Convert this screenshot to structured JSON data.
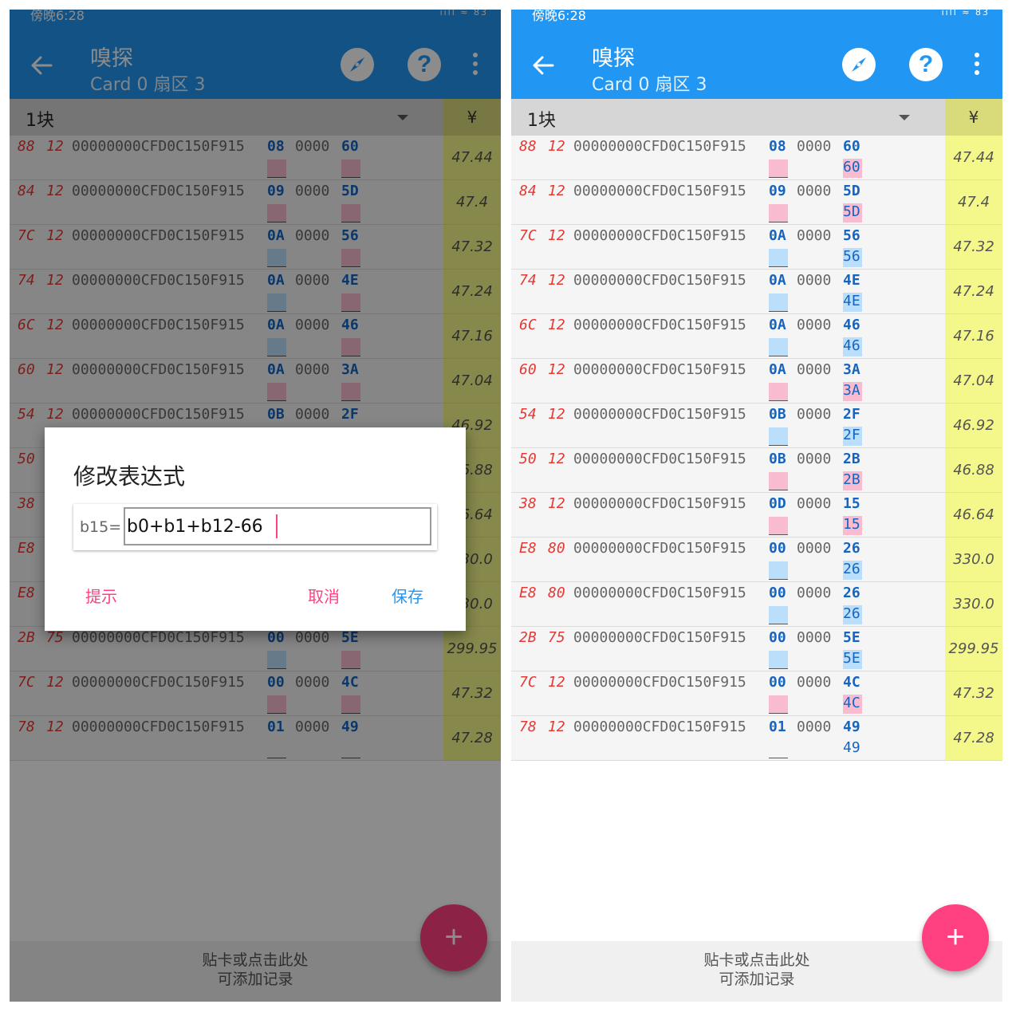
{
  "statusbar": {
    "time": "傍晚6:28",
    "icons": "ııll ≈ 83"
  },
  "appbar": {
    "title": "嗅探",
    "subtitle": "Card 0 扇区 3",
    "background": "#2196f3"
  },
  "header": {
    "block_label": "1块",
    "currency": "¥"
  },
  "rows": [
    {
      "c1": "88",
      "c2": "12",
      "uid": "00000000CFD0C150F915",
      "b12": "08",
      "zz": "0000",
      "b15": "60",
      "calc": "60",
      "indicator": "pink",
      "price": "47.44"
    },
    {
      "c1": "84",
      "c2": "12",
      "uid": "00000000CFD0C150F915",
      "b12": "09",
      "zz": "0000",
      "b15": "5D",
      "calc": "5D",
      "indicator": "pink",
      "price": "47.4"
    },
    {
      "c1": "7C",
      "c2": "12",
      "uid": "00000000CFD0C150F915",
      "b12": "0A",
      "zz": "0000",
      "b15": "56",
      "calc": "56",
      "indicator": "blue",
      "price": "47.32"
    },
    {
      "c1": "74",
      "c2": "12",
      "uid": "00000000CFD0C150F915",
      "b12": "0A",
      "zz": "0000",
      "b15": "4E",
      "calc": "4E",
      "indicator": "blue",
      "price": "47.24"
    },
    {
      "c1": "6C",
      "c2": "12",
      "uid": "00000000CFD0C150F915",
      "b12": "0A",
      "zz": "0000",
      "b15": "46",
      "calc": "46",
      "indicator": "blue",
      "price": "47.16"
    },
    {
      "c1": "60",
      "c2": "12",
      "uid": "00000000CFD0C150F915",
      "b12": "0A",
      "zz": "0000",
      "b15": "3A",
      "calc": "3A",
      "indicator": "pink",
      "price": "47.04"
    },
    {
      "c1": "54",
      "c2": "12",
      "uid": "00000000CFD0C150F915",
      "b12": "0B",
      "zz": "0000",
      "b15": "2F",
      "calc": "2F",
      "indicator": "blue",
      "price": "46.92"
    },
    {
      "c1": "50",
      "c2": "12",
      "uid": "00000000CFD0C150F915",
      "b12": "0B",
      "zz": "0000",
      "b15": "2B",
      "calc": "2B",
      "indicator": "pink",
      "price": "46.88"
    },
    {
      "c1": "38",
      "c2": "12",
      "uid": "00000000CFD0C150F915",
      "b12": "0D",
      "zz": "0000",
      "b15": "15",
      "calc": "15",
      "indicator": "pink",
      "price": "46.64"
    },
    {
      "c1": "E8",
      "c2": "80",
      "uid": "00000000CFD0C150F915",
      "b12": "00",
      "zz": "0000",
      "b15": "26",
      "calc": "26",
      "indicator": "blue",
      "price": "330.0"
    },
    {
      "c1": "E8",
      "c2": "80",
      "uid": "00000000CFD0C150F915",
      "b12": "00",
      "zz": "0000",
      "b15": "26",
      "calc": "26",
      "indicator": "blue",
      "price": "330.0"
    },
    {
      "c1": "2B",
      "c2": "75",
      "uid": "00000000CFD0C150F915",
      "b12": "00",
      "zz": "0000",
      "b15": "5E",
      "calc": "5E",
      "indicator": "blue",
      "price": "299.95"
    },
    {
      "c1": "7C",
      "c2": "12",
      "uid": "00000000CFD0C150F915",
      "b12": "00",
      "zz": "0000",
      "b15": "4C",
      "calc": "4C",
      "indicator": "pink",
      "price": "47.32"
    },
    {
      "c1": "78",
      "c2": "12",
      "uid": "00000000CFD0C150F915",
      "b12": "01",
      "zz": "0000",
      "b15": "49",
      "calc": "49",
      "indicator": "none",
      "price": "47.28"
    }
  ],
  "footer": {
    "line1": "贴卡或点击此处",
    "line2": "可添加记录"
  },
  "fab": {
    "label": "+"
  },
  "dialog": {
    "title": "修改表达式",
    "prefix": "b15=",
    "value": "b0+b1+b12-66",
    "hint_button": "提示",
    "cancel_button": "取消",
    "save_button": "保存"
  },
  "colors": {
    "accent": "#ff4081",
    "primary": "#2196f3",
    "price_bg": "#f4f78a",
    "pink": "#f8bbd0",
    "blue": "#bbdefb"
  }
}
